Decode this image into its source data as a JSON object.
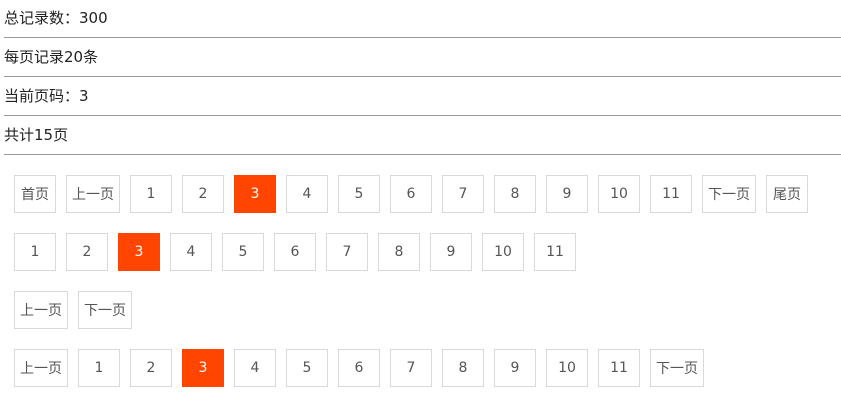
{
  "summary": {
    "total_records": "总记录数：300",
    "per_page": "每页记录20条",
    "current_page": "当前页码：3",
    "total_pages": "共计15页"
  },
  "labels": {
    "first": "首页",
    "prev": "上一页",
    "next": "下一页",
    "last": "尾页"
  },
  "pages": [
    "1",
    "2",
    "3",
    "4",
    "5",
    "6",
    "7",
    "8",
    "9",
    "10",
    "11"
  ],
  "current": "3",
  "accent_color": "#ff4500"
}
